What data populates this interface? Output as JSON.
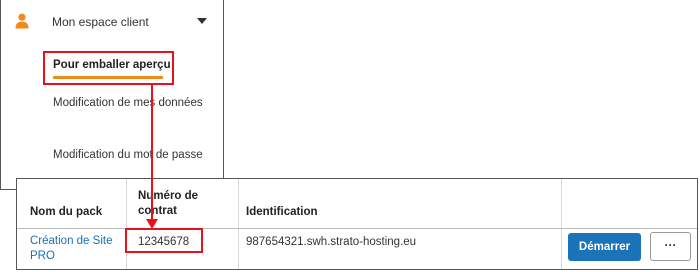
{
  "sidebar": {
    "title": "Mon espace client",
    "items": [
      {
        "label": "Pour emballer aperçu"
      },
      {
        "label": "Modification de mes données"
      },
      {
        "label": "Modification du mot de passe"
      }
    ]
  },
  "table": {
    "headers": [
      "Nom du pack",
      "Numéro de contrat",
      "Identification",
      ""
    ],
    "rows": [
      {
        "pack": "Création de Site PRO",
        "contract": "12345678",
        "identification": "987654321.swh.strato-hosting.eu",
        "primary_action": "Démarrer",
        "more_action": "···"
      }
    ]
  },
  "colors": {
    "accent_orange": "#f08a1c",
    "highlight_red": "#e8111b",
    "primary_blue": "#1b73b8",
    "link_blue": "#1a6fb5"
  },
  "icons": {
    "user": "user-icon",
    "caret": "caret-down-icon"
  }
}
